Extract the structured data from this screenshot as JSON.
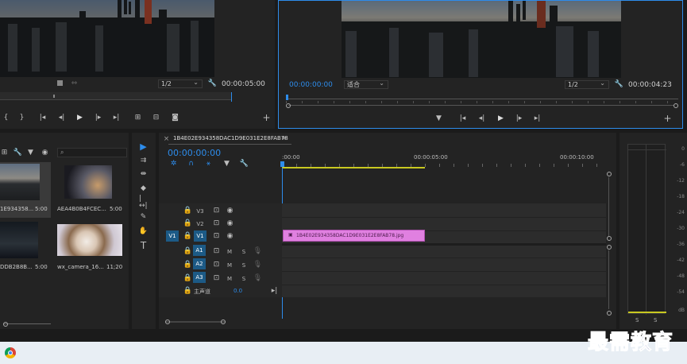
{
  "source_monitor": {
    "zoom": "1/2",
    "duration": "00:00:05:00"
  },
  "program_monitor": {
    "timecode": "00:00:00:00",
    "fit": "适合",
    "zoom": "1/2",
    "duration": "00:00:04:23"
  },
  "project": {
    "search_placeholder": "",
    "items": [
      {
        "name": "1E934358...",
        "duration": "5:00"
      },
      {
        "name": "AEA4B0B4FCEC...",
        "duration": "5:00"
      },
      {
        "name": "DDB2B8B...",
        "duration": "5:00"
      },
      {
        "name": "wx_camera_16...",
        "duration": "11;20"
      }
    ]
  },
  "timeline": {
    "sequence_name": "1B4E02E934358DAC1D9E031E2E8FAB78",
    "menu_icon": "≡",
    "timecode": "00:00:00:00",
    "ruler": [
      ":00:00",
      "00:00:05:00",
      "00:00:10:00"
    ],
    "video_tracks": [
      "V3",
      "V2",
      "V1"
    ],
    "source_patch": "V1",
    "audio_tracks": [
      "A1",
      "A2",
      "A3"
    ],
    "mute_label": "M",
    "solo_label": "S",
    "master_label": "主声道",
    "master_value": "0.0",
    "clip_name": "1B4E02E934358DAC1D9E031E2E8FAB78.jpg"
  },
  "meter": {
    "scale": [
      "0",
      "-6",
      "-12",
      "-18",
      "-24",
      "-30",
      "-36",
      "-42",
      "-48",
      "-54",
      "dB"
    ],
    "solo": [
      "S",
      "S"
    ]
  },
  "watermark": "最需教育",
  "colors": {
    "accent": "#2d8ceb",
    "clip": "#e080e0",
    "work_area": "#c8c820"
  }
}
